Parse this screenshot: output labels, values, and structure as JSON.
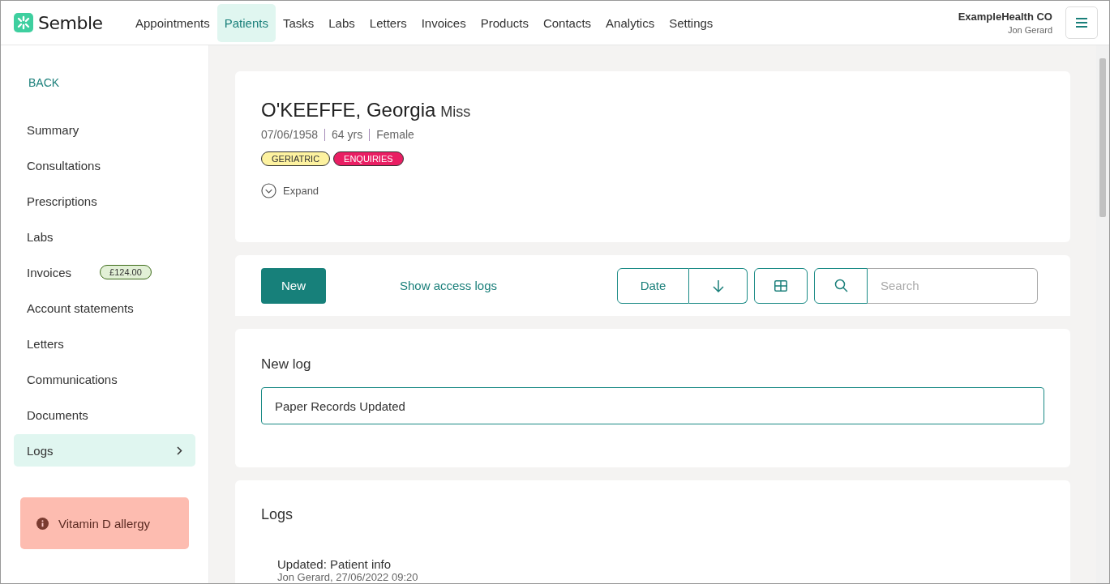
{
  "brand": "Semble",
  "nav": [
    {
      "label": "Appointments",
      "selected": false
    },
    {
      "label": "Patients",
      "selected": true
    },
    {
      "label": "Tasks",
      "selected": false
    },
    {
      "label": "Labs",
      "selected": false
    },
    {
      "label": "Letters",
      "selected": false
    },
    {
      "label": "Invoices",
      "selected": false
    },
    {
      "label": "Products",
      "selected": false
    },
    {
      "label": "Contacts",
      "selected": false
    },
    {
      "label": "Analytics",
      "selected": false
    },
    {
      "label": "Settings",
      "selected": false
    }
  ],
  "account": {
    "company": "ExampleHealth CO",
    "user": "Jon Gerard"
  },
  "sidebar": {
    "back": "BACK",
    "items": [
      {
        "label": "Summary",
        "selected": false
      },
      {
        "label": "Consultations",
        "selected": false
      },
      {
        "label": "Prescriptions",
        "selected": false
      },
      {
        "label": "Labs",
        "selected": false
      },
      {
        "label": "Invoices",
        "selected": false,
        "badge": "£124.00"
      },
      {
        "label": "Account statements",
        "selected": false
      },
      {
        "label": "Letters",
        "selected": false
      },
      {
        "label": "Communications",
        "selected": false
      },
      {
        "label": "Documents",
        "selected": false
      },
      {
        "label": "Logs",
        "selected": true
      }
    ],
    "alert": "Vitamin D allergy"
  },
  "patient": {
    "name": "O'KEEFFE, Georgia",
    "title": "Miss",
    "details": [
      "07/06/1958",
      "64 yrs",
      "Female"
    ],
    "tags": [
      {
        "label": "GERIATRIC",
        "color": "#fdf2a0"
      },
      {
        "label": "ENQUIRIES",
        "color": "#e91e63"
      }
    ],
    "expand": "Expand"
  },
  "toolbar": {
    "new": "New",
    "access_logs": "Show access logs",
    "sort": "Date",
    "search": {
      "placeholder": "Search"
    }
  },
  "new_log": {
    "title": "New log",
    "value": "Paper Records Updated"
  },
  "logs": {
    "title": "Logs",
    "entries": [
      {
        "title": "Updated: Patient info",
        "meta": "Jon Gerard, 27/06/2022 09:20"
      }
    ]
  }
}
